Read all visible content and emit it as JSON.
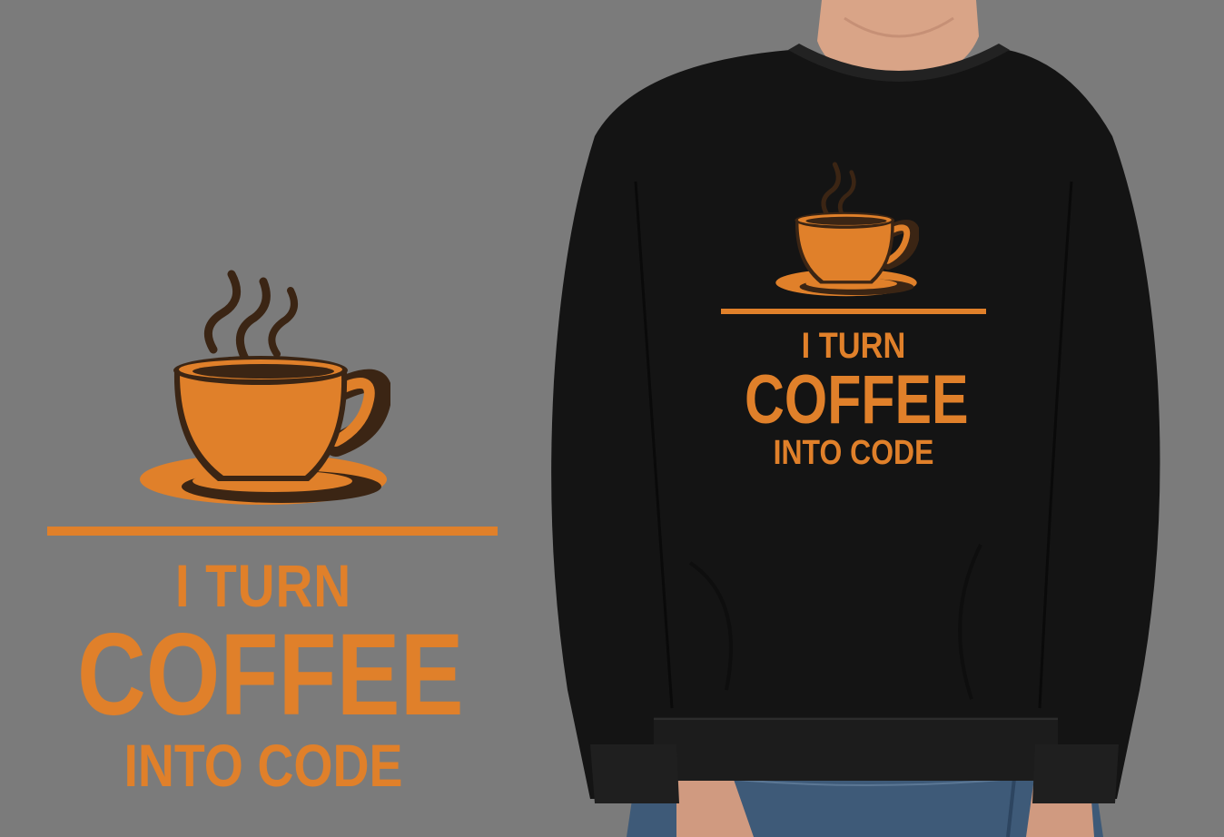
{
  "slogan": {
    "line1": "I TURN",
    "line2": "COFFEE",
    "line3": "INTO CODE"
  },
  "icons": {
    "cup": "coffee-cup-icon"
  },
  "colors": {
    "background": "#7b7b7b",
    "accent_orange": "#e0802a",
    "coffee_brown": "#3b2514",
    "sweatshirt": "#141414",
    "skin": "#d9a487",
    "denim": "#3e5a78"
  }
}
